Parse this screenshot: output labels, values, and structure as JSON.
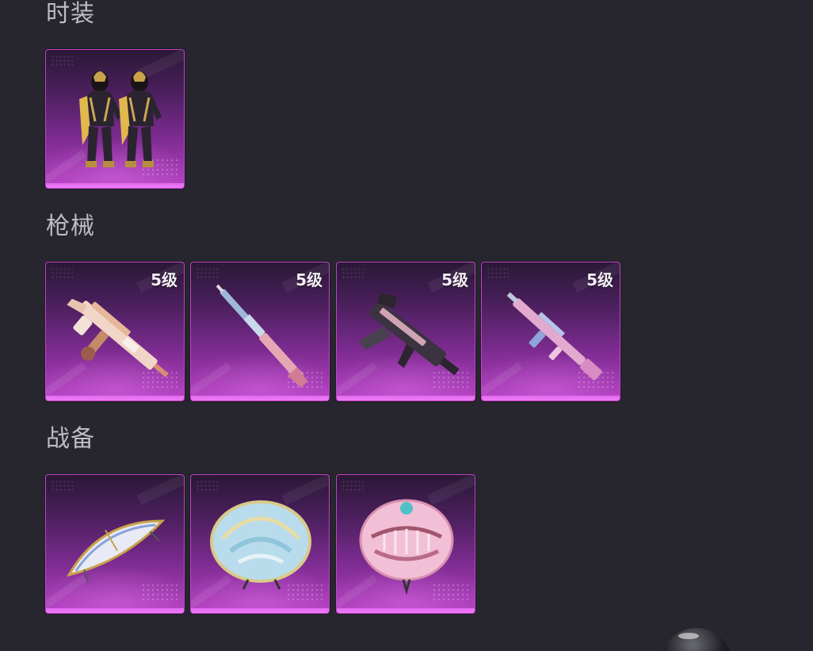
{
  "sections": {
    "outfit": {
      "title": "时装",
      "items": [
        {
          "icon": "outfit-pair-icon"
        }
      ]
    },
    "guns": {
      "title": "枪械",
      "items": [
        {
          "icon": "smg-skin-icon",
          "level": "5级"
        },
        {
          "icon": "rifle-skin-icon",
          "level": "5级"
        },
        {
          "icon": "dark-smg-skin-icon",
          "level": "5级"
        },
        {
          "icon": "assault-rifle-skin-icon",
          "level": "5级"
        }
      ]
    },
    "equipment": {
      "title": "战备",
      "items": [
        {
          "icon": "glider-skin-icon"
        },
        {
          "icon": "parachute-blue-icon"
        },
        {
          "icon": "parachute-pink-icon"
        }
      ]
    }
  },
  "colors": {
    "background": "#27262f",
    "card_border": "#c044c9",
    "card_bottom_bar": "#f07bf6",
    "title_text": "#bdbcc4"
  }
}
